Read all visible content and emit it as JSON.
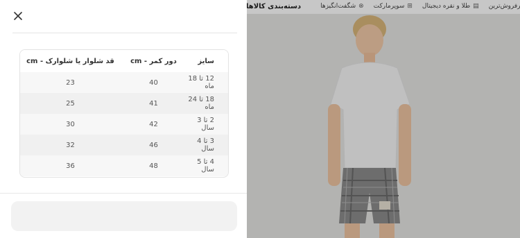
{
  "background": {
    "nav": {
      "categories": "دسته‌بندی کالاها",
      "items": [
        {
          "label": "شگفت‌انگیزها",
          "icon": "percent-icon"
        },
        {
          "label": "سوپرمارکت",
          "icon": "basket-icon"
        },
        {
          "label": "طلا و نقره دیجیتال",
          "icon": "gold-icon"
        },
        {
          "label": "پرفروش‌ترین",
          "icon": "fire-icon"
        }
      ]
    }
  },
  "modal": {
    "table": {
      "headers": [
        "سایز",
        "دور کمر - cm",
        "قد شلوار یا شلوارک - cm"
      ],
      "rows": [
        [
          "12 تا 18 ماه",
          "40",
          "23"
        ],
        [
          "18 تا 24 ماه",
          "41",
          "25"
        ],
        [
          "2 تا 3 سال",
          "42",
          "30"
        ],
        [
          "3 تا 4 سال",
          "46",
          "32"
        ],
        [
          "4 تا 5 سال",
          "48",
          "36"
        ]
      ]
    },
    "footer_button": ""
  }
}
